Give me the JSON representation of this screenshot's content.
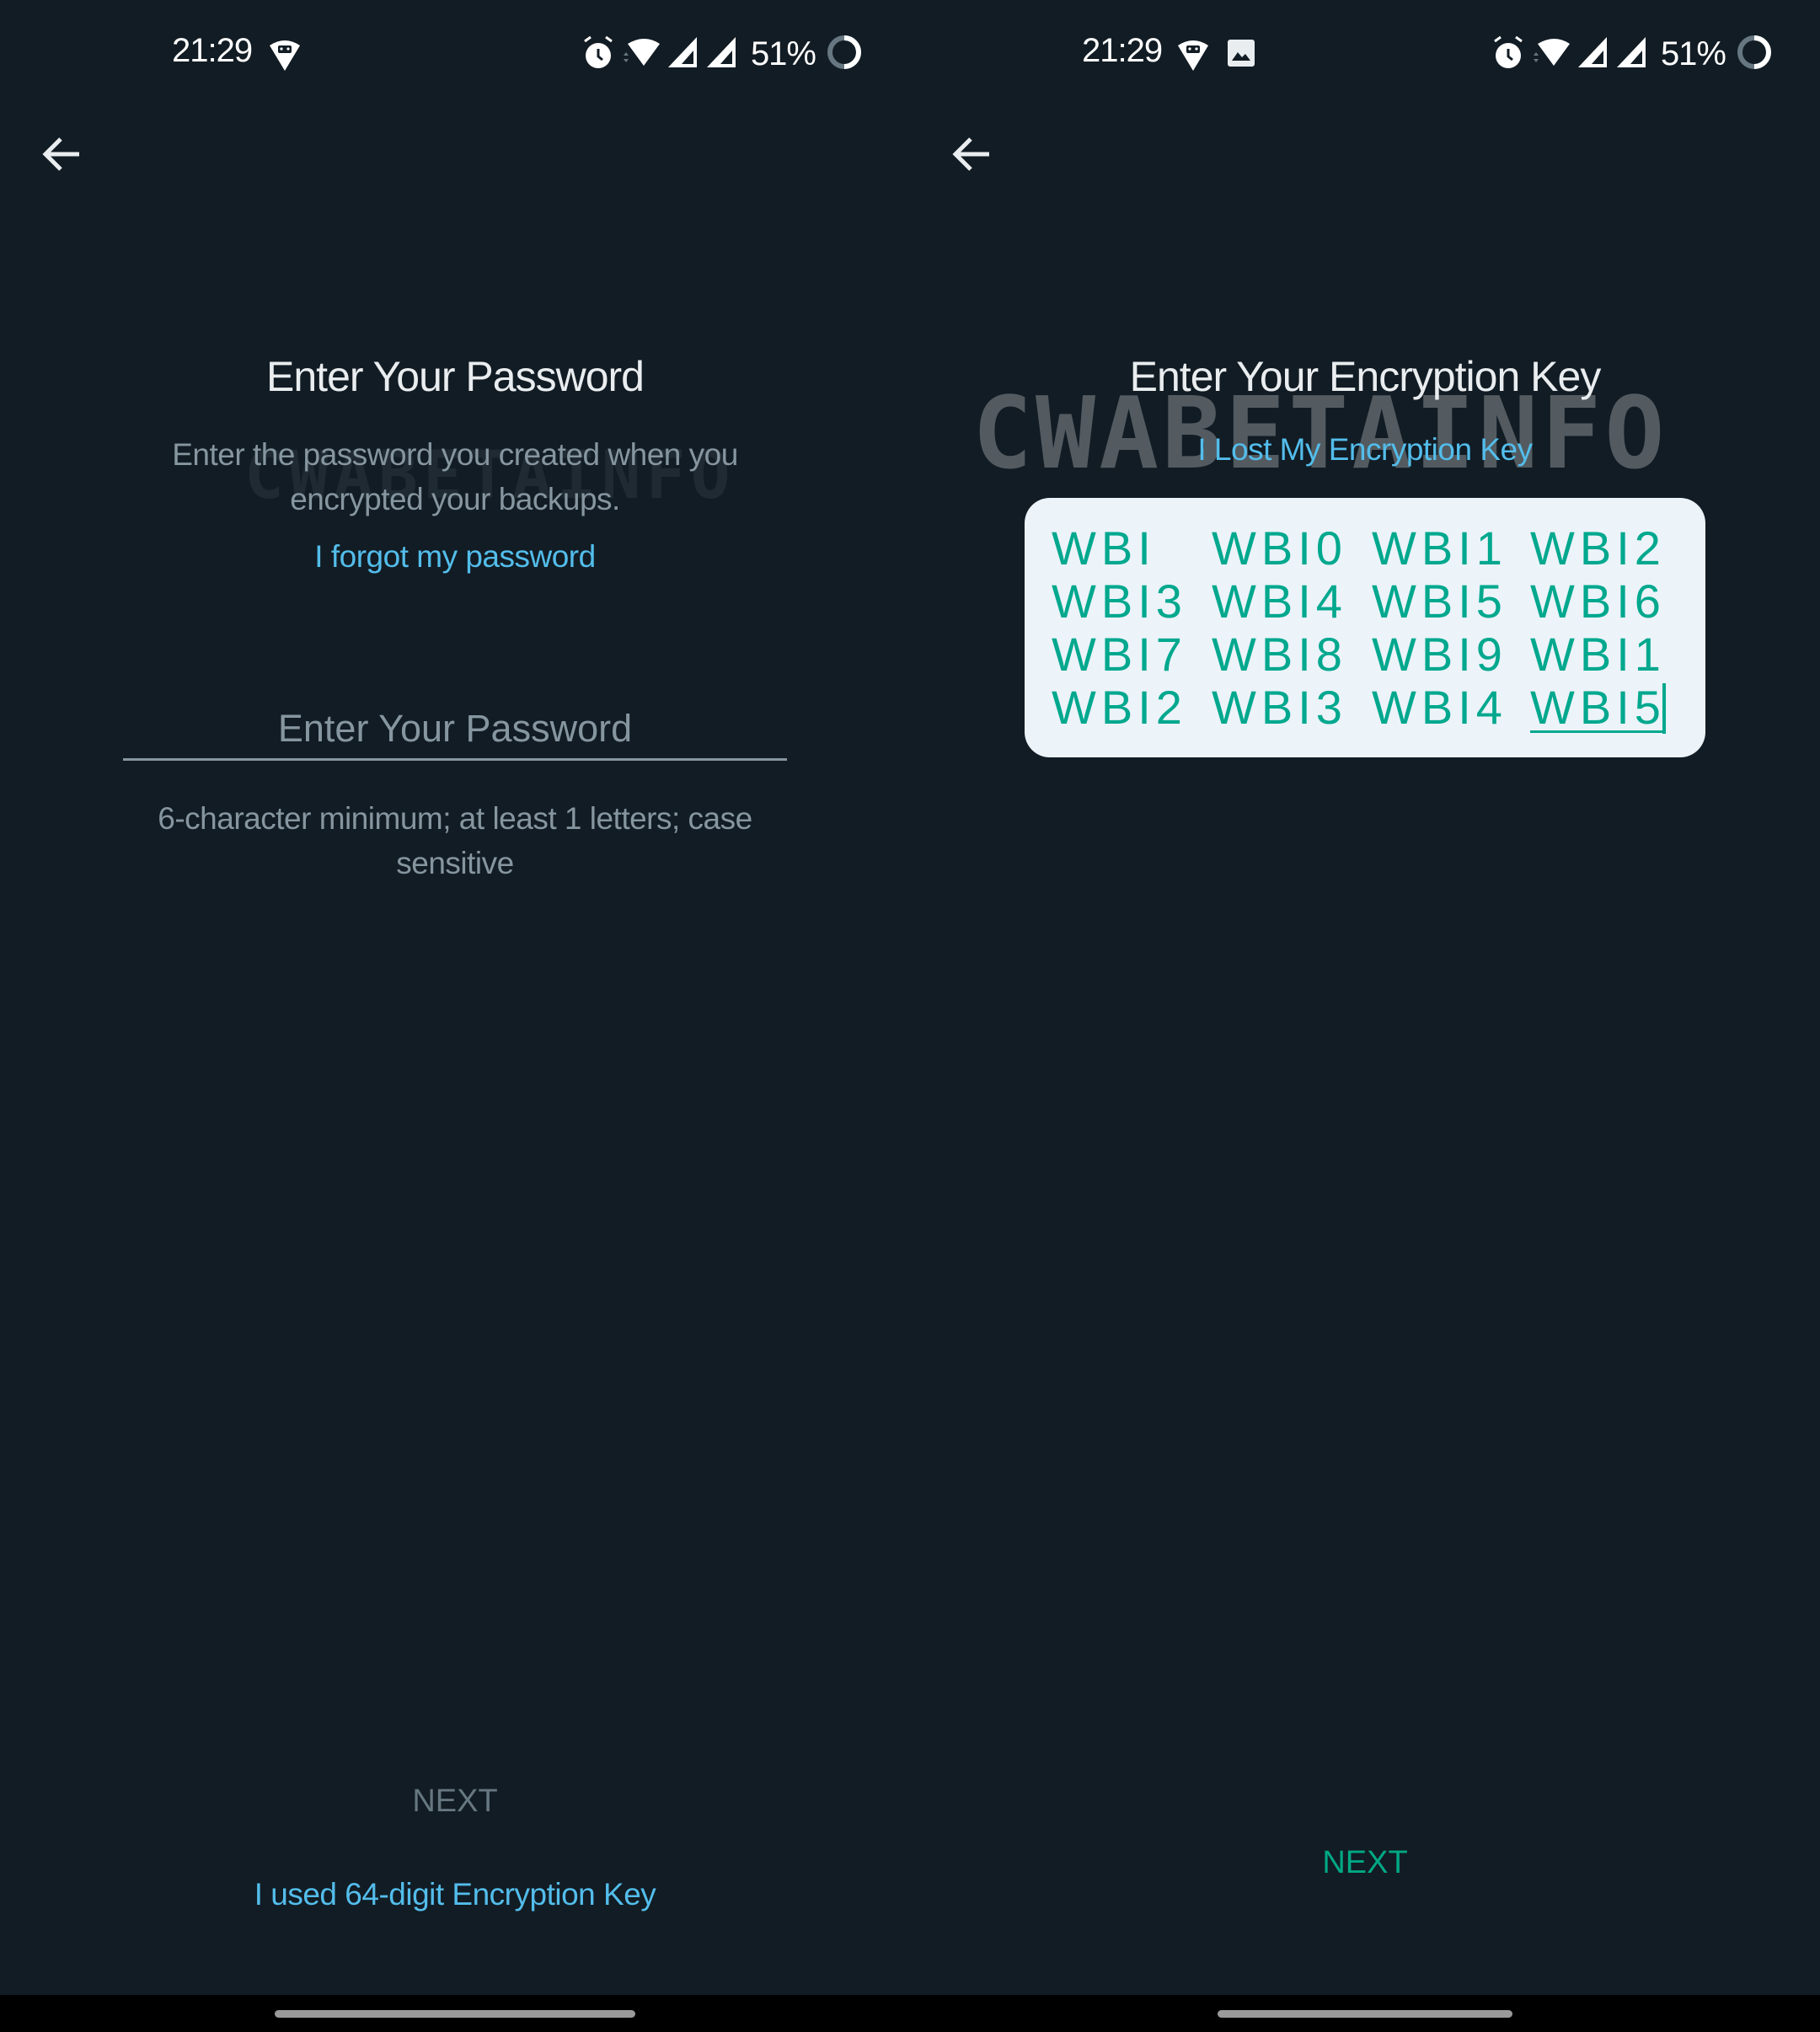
{
  "left_screen": {
    "status_bar": {
      "time": "21:29",
      "notification_icons": [
        "android-debug-icon"
      ],
      "system_icons": [
        "alarm-icon",
        "wifi-icon",
        "signal-icon",
        "signal-icon"
      ],
      "battery_percent": "51%"
    },
    "title": "Enter Your Password",
    "subtitle_line1": "Enter the password you created when you",
    "subtitle_line2": "encrypted your backups.",
    "forgot_link": "I forgot my password",
    "password_field": {
      "value": "",
      "placeholder": "Enter Your Password"
    },
    "hint_line1": "6-character minimum; at least 1 letters; case",
    "hint_line2": "sensitive",
    "next_label": "NEXT",
    "alt_link": "I used 64-digit Encryption Key",
    "watermark": "CWABETAINFO"
  },
  "right_screen": {
    "status_bar": {
      "time": "21:29",
      "notification_icons": [
        "android-debug-icon",
        "image-icon"
      ],
      "system_icons": [
        "alarm-icon",
        "wifi-icon",
        "signal-icon",
        "signal-icon"
      ],
      "battery_percent": "51%"
    },
    "title": "Enter Your Encryption Key",
    "lost_key_link": "I Lost My Encryption Key",
    "key_cells": [
      "WBI",
      "WBI0",
      "WBI1",
      "WBI2",
      "WBI3",
      "WBI4",
      "WBI5",
      "WBI6",
      "WBI7",
      "WBI8",
      "WBI9",
      "WBI1",
      "WBI2",
      "WBI3",
      "WBI4",
      "WBI5"
    ],
    "next_label": "NEXT",
    "watermark": "CWABETAINFO"
  },
  "colors": {
    "background": "#121c24",
    "accent_teal": "#00a884",
    "link_blue": "#53bdeb",
    "key_box_bg": "#ecf3f9"
  }
}
